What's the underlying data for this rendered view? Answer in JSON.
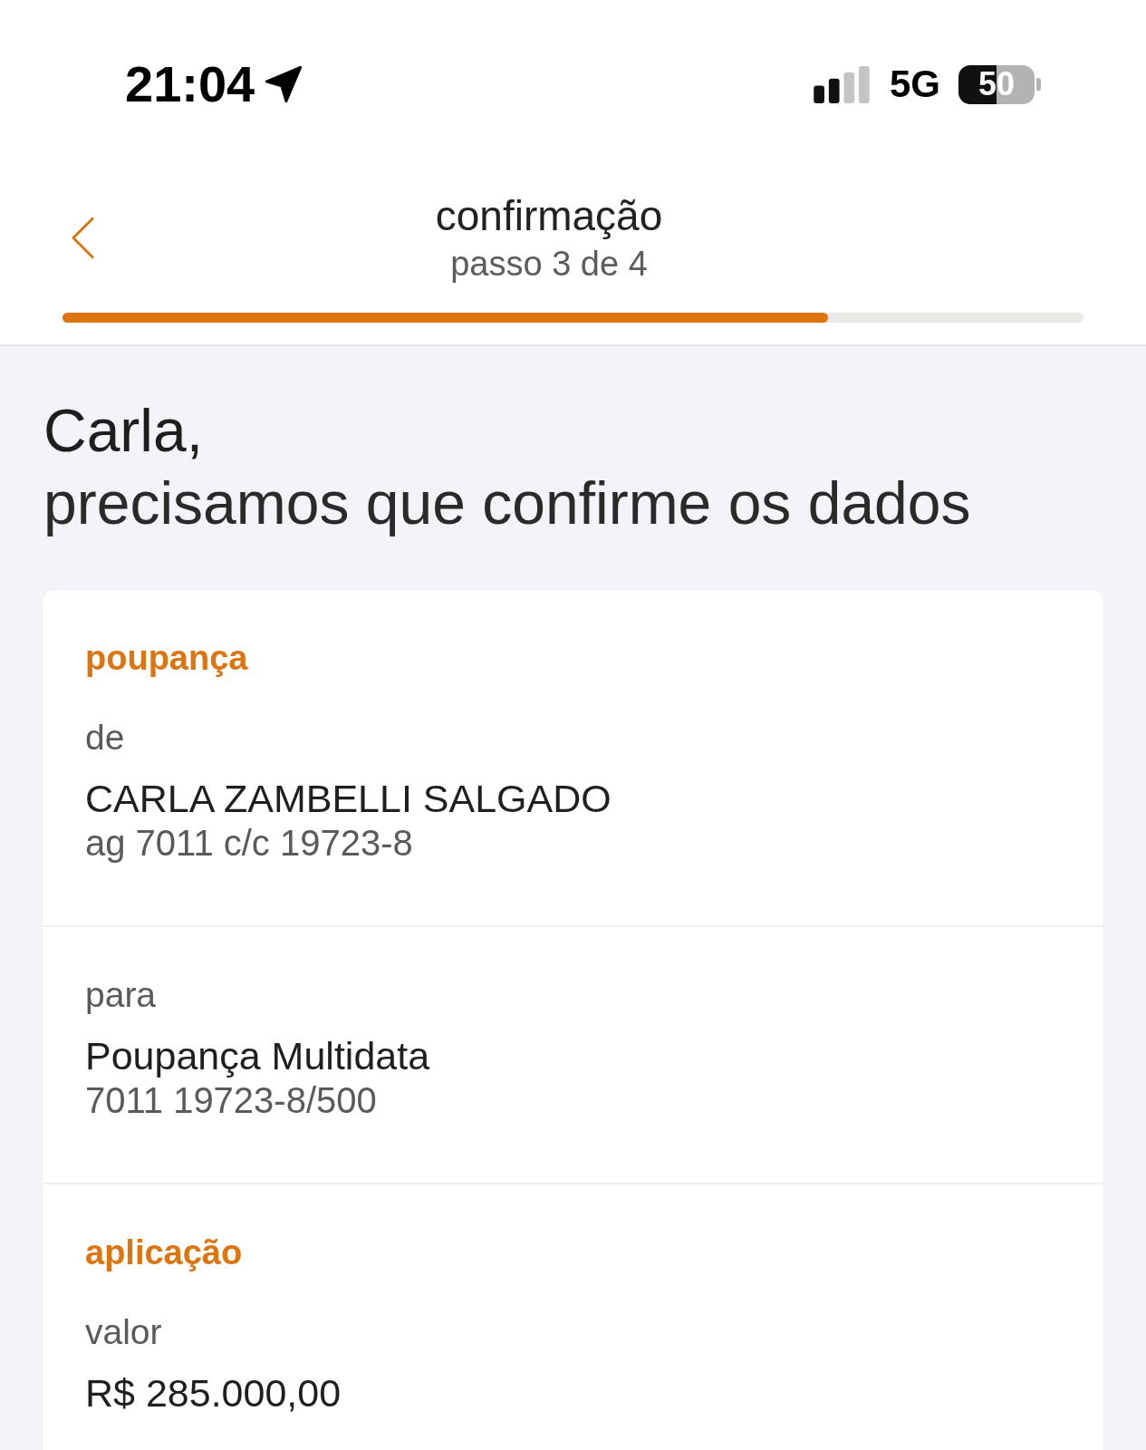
{
  "status_bar": {
    "time": "21:04",
    "network": "5G",
    "battery": "50"
  },
  "header": {
    "title": "confirmação",
    "subtitle": "passo 3 de 4",
    "progress": {
      "level": 0.75
    }
  },
  "greeting": {
    "name": "Carla,",
    "message": "precisamos que confirme os dados"
  },
  "card": {
    "sections": [
      {
        "heading": "poupança",
        "fields": [
          {
            "label": "de",
            "value": "CARLA ZAMBELLI SALGADO",
            "detail": "ag 7011 c/c 19723-8"
          }
        ]
      },
      {
        "fields": [
          {
            "label": "para",
            "value": "Poupança Multidata",
            "detail": "7011 19723-8/500"
          }
        ]
      },
      {
        "heading": "aplicação",
        "fields": [
          {
            "label": "valor",
            "value": "R$ 285.000,00"
          }
        ]
      }
    ]
  }
}
